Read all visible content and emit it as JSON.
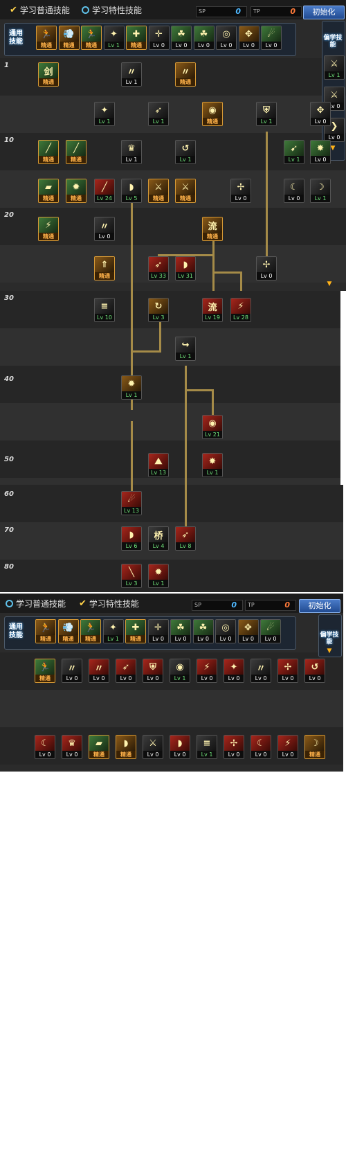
{
  "header": {
    "learn_normal": "学习普通技能",
    "learn_special": "学习特性技能",
    "sp1_label": "SP",
    "sp1_value": "0",
    "sp2_label": "TP",
    "sp2_value": "0",
    "reset": "初始化"
  },
  "common": {
    "label": "通用技能"
  },
  "side": {
    "title": "偏学技能"
  },
  "levels": [
    "1",
    "10",
    "20",
    "30",
    "40",
    "50",
    "60",
    "70",
    "80"
  ],
  "colors": {
    "normal_value": "#4fb8ff",
    "special_value": "#ff7a3a",
    "connector": "#a58b48"
  },
  "common_skills": [
    {
      "label": "精通",
      "tone": "adv",
      "art": "gold",
      "icon": "🏃"
    },
    {
      "label": "精通",
      "tone": "adv",
      "art": "gold",
      "icon": "💨"
    },
    {
      "label": "精通",
      "tone": "adv",
      "art": "green",
      "icon": "🏃"
    },
    {
      "label": "Lv 1",
      "tone": "g",
      "art": "dark",
      "icon": "✦"
    },
    {
      "label": "精通",
      "tone": "adv",
      "art": "green",
      "icon": "✚"
    },
    {
      "label": "Lv 0",
      "tone": "w",
      "art": "dark",
      "icon": "✛"
    },
    {
      "label": "Lv 0",
      "tone": "w",
      "art": "green",
      "icon": "☘"
    },
    {
      "label": "Lv 0",
      "tone": "w",
      "art": "green",
      "icon": "☘"
    },
    {
      "label": "Lv 0",
      "tone": "w",
      "art": "dark",
      "icon": "◎"
    },
    {
      "label": "Lv 0",
      "tone": "w",
      "art": "gold",
      "icon": "✥"
    },
    {
      "label": "Lv 0",
      "tone": "w",
      "art": "green",
      "icon": "☄"
    }
  ],
  "side_skills": [
    {
      "label": "Lv 1",
      "tone": "g",
      "art": "dark",
      "icon": "⚔"
    },
    {
      "label": "Lv 0",
      "tone": "w",
      "art": "dark",
      "icon": "⚔"
    },
    {
      "label": "Lv 0",
      "tone": "w",
      "art": "dark",
      "icon": "❯"
    }
  ],
  "tree_skills": [
    {
      "label": "精通",
      "tone": "adv",
      "art": "green",
      "icon": "剑"
    },
    {
      "label": "Lv 1",
      "tone": "w",
      "art": "dark",
      "icon": "〃"
    },
    {
      "label": "精通",
      "tone": "adv",
      "art": "gold",
      "icon": "〃"
    },
    {
      "label": "Lv 1",
      "tone": "g",
      "art": "dark",
      "icon": "✦"
    },
    {
      "label": "Lv 1",
      "tone": "g",
      "art": "dark",
      "icon": "➶"
    },
    {
      "label": "精通",
      "tone": "adv",
      "art": "gold",
      "icon": "◉"
    },
    {
      "label": "Lv 1",
      "tone": "g",
      "art": "dark",
      "icon": "⛨"
    },
    {
      "label": "Lv 0",
      "tone": "w",
      "art": "dark",
      "icon": "✥"
    },
    {
      "label": "精通",
      "tone": "adv",
      "art": "green",
      "icon": "╱"
    },
    {
      "label": "精通",
      "tone": "adv",
      "art": "green",
      "icon": "╱"
    },
    {
      "label": "Lv 1",
      "tone": "w",
      "art": "dark",
      "icon": "♛"
    },
    {
      "label": "Lv 1",
      "tone": "g",
      "art": "dark",
      "icon": "↺"
    },
    {
      "label": "Lv 1",
      "tone": "g",
      "art": "green",
      "icon": "➹"
    },
    {
      "label": "Lv 0",
      "tone": "w",
      "art": "green",
      "icon": "✸"
    },
    {
      "label": "精通",
      "tone": "adv",
      "art": "green",
      "icon": "▰"
    },
    {
      "label": "精通",
      "tone": "adv",
      "art": "green",
      "icon": "✹"
    },
    {
      "label": "Lv 24",
      "tone": "g",
      "art": "red",
      "icon": "╱"
    },
    {
      "label": "Lv 5",
      "tone": "g",
      "art": "dark",
      "icon": "◗"
    },
    {
      "label": "精通",
      "tone": "adv",
      "art": "gold",
      "icon": "⚔"
    },
    {
      "label": "精通",
      "tone": "adv",
      "art": "gold",
      "icon": "⚔"
    },
    {
      "label": "Lv 0",
      "tone": "w",
      "art": "dark",
      "icon": "✢"
    },
    {
      "label": "Lv 0",
      "tone": "w",
      "art": "dark",
      "icon": "☾"
    },
    {
      "label": "Lv 1",
      "tone": "g",
      "art": "dark",
      "icon": "☽"
    },
    {
      "label": "精通",
      "tone": "adv",
      "art": "green",
      "icon": "⚡"
    },
    {
      "label": "Lv 0",
      "tone": "w",
      "art": "dark",
      "icon": "〃"
    },
    {
      "label": "精通",
      "tone": "adv",
      "art": "gold",
      "icon": "流"
    },
    {
      "label": "精通",
      "tone": "adv",
      "art": "gold",
      "icon": "⇑"
    },
    {
      "label": "Lv 33",
      "tone": "g",
      "art": "red",
      "icon": "➶"
    },
    {
      "label": "Lv 31",
      "tone": "g",
      "art": "red",
      "icon": "◗"
    },
    {
      "label": "Lv 0",
      "tone": "w",
      "art": "dark",
      "icon": "✢"
    },
    {
      "label": "Lv 10",
      "tone": "g",
      "art": "dark",
      "icon": "≡"
    },
    {
      "label": "Lv 3",
      "tone": "g",
      "art": "gold",
      "icon": "↻"
    },
    {
      "label": "Lv 19",
      "tone": "g",
      "art": "red",
      "icon": "流"
    },
    {
      "label": "Lv 28",
      "tone": "g",
      "art": "red",
      "icon": "⚡"
    },
    {
      "label": "Lv 1",
      "tone": "g",
      "art": "dark",
      "icon": "↪"
    },
    {
      "label": "Lv 1",
      "tone": "g",
      "art": "gold",
      "icon": "✹"
    },
    {
      "label": "Lv 21",
      "tone": "g",
      "art": "red",
      "icon": "◉"
    },
    {
      "label": "Lv 13",
      "tone": "g",
      "art": "red",
      "icon": "⛰"
    },
    {
      "label": "Lv 1",
      "tone": "g",
      "art": "red",
      "icon": "✸"
    },
    {
      "label": "Lv 13",
      "tone": "g",
      "art": "red",
      "icon": "☄"
    },
    {
      "label": "Lv 6",
      "tone": "g",
      "art": "red",
      "icon": "◗"
    },
    {
      "label": "Lv 4",
      "tone": "g",
      "art": "dark",
      "icon": "桥"
    },
    {
      "label": "Lv 8",
      "tone": "g",
      "art": "red",
      "icon": "➶"
    },
    {
      "label": "Lv 3",
      "tone": "g",
      "art": "red",
      "icon": "╲"
    },
    {
      "label": "Lv 1",
      "tone": "g",
      "art": "red",
      "icon": "✹"
    }
  ],
  "special_row1": [
    {
      "label": "精通",
      "tone": "adv",
      "art": "green",
      "icon": "🏃"
    },
    {
      "label": "Lv 0",
      "tone": "w",
      "art": "dark",
      "icon": "〃"
    },
    {
      "label": "Lv 0",
      "tone": "w",
      "art": "red",
      "icon": "〃"
    },
    {
      "label": "Lv 0",
      "tone": "w",
      "art": "red",
      "icon": "➶"
    },
    {
      "label": "Lv 0",
      "tone": "w",
      "art": "red",
      "icon": "⛨"
    },
    {
      "label": "Lv 1",
      "tone": "g",
      "art": "dark",
      "icon": "◉"
    },
    {
      "label": "Lv 0",
      "tone": "w",
      "art": "red",
      "icon": "⚡"
    },
    {
      "label": "Lv 0",
      "tone": "w",
      "art": "red",
      "icon": "✦"
    },
    {
      "label": "Lv 0",
      "tone": "w",
      "art": "dark",
      "icon": "〃"
    },
    {
      "label": "Lv 0",
      "tone": "w",
      "art": "red",
      "icon": "✢"
    },
    {
      "label": "Lv 0",
      "tone": "w",
      "art": "red",
      "icon": "↺"
    }
  ],
  "special_row2": [
    {
      "label": "Lv 0",
      "tone": "w",
      "art": "red",
      "icon": "☾"
    },
    {
      "label": "Lv 0",
      "tone": "w",
      "art": "red",
      "icon": "♛"
    },
    {
      "label": "精通",
      "tone": "adv",
      "art": "green",
      "icon": "▰"
    },
    {
      "label": "精通",
      "tone": "adv",
      "art": "gold",
      "icon": "◗"
    },
    {
      "label": "Lv 0",
      "tone": "w",
      "art": "dark",
      "icon": "⚔"
    },
    {
      "label": "Lv 0",
      "tone": "w",
      "art": "red",
      "icon": "◗"
    },
    {
      "label": "Lv 1",
      "tone": "g",
      "art": "dark",
      "icon": "≡"
    },
    {
      "label": "Lv 0",
      "tone": "w",
      "art": "red",
      "icon": "✢"
    },
    {
      "label": "Lv 0",
      "tone": "w",
      "art": "red",
      "icon": "☾"
    },
    {
      "label": "Lv 0",
      "tone": "w",
      "art": "red",
      "icon": "⚡"
    },
    {
      "label": "精通",
      "tone": "adv",
      "art": "gold",
      "icon": "☽"
    }
  ]
}
